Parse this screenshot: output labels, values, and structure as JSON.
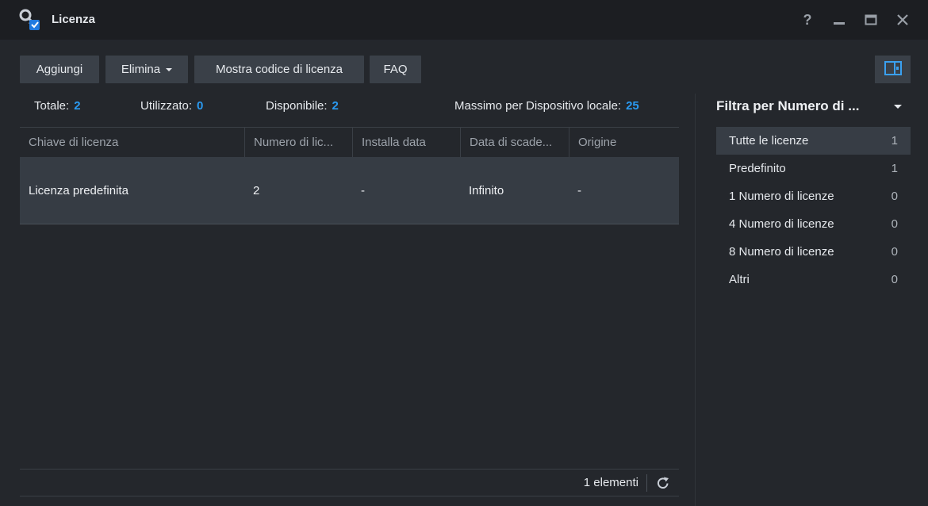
{
  "window": {
    "title": "Licenza"
  },
  "toolbar": {
    "add_label": "Aggiungi",
    "delete_label": "Elimina",
    "show_code_label": "Mostra codice di licenza",
    "faq_label": "FAQ"
  },
  "stats": {
    "total_label": "Totale:",
    "total_value": "2",
    "used_label": "Utilizzato:",
    "used_value": "0",
    "available_label": "Disponibile:",
    "available_value": "2",
    "max_label": "Massimo per Dispositivo locale:",
    "max_value": "25"
  },
  "table": {
    "columns": [
      "Chiave di licenza",
      "Numero di lic...",
      "Installa data",
      "Data di scade...",
      "Origine"
    ],
    "rows": [
      [
        "Licenza predefinita",
        "2",
        "-",
        "Infinito",
        "-"
      ]
    ]
  },
  "footer": {
    "item_count": "1 elementi"
  },
  "sidebar": {
    "title": "Filtra per Numero di ...",
    "items": [
      {
        "label": "Tutte le licenze",
        "count": "1"
      },
      {
        "label": "Predefinito",
        "count": "1"
      },
      {
        "label": "1 Numero di licenze",
        "count": "0"
      },
      {
        "label": "4 Numero di licenze",
        "count": "0"
      },
      {
        "label": "8 Numero di licenze",
        "count": "0"
      },
      {
        "label": "Altri",
        "count": "0"
      }
    ]
  },
  "colors": {
    "accent": "#2a9af1",
    "background": "#24272c",
    "titlebar": "#1c1e22",
    "button": "#3a4048",
    "selected_row": "#363c44"
  },
  "icons": {
    "app": "license-key-icon",
    "help": "help-icon",
    "minimize": "minimize-icon",
    "maximize": "maximize-icon",
    "close": "close-icon",
    "panel": "side-panel-icon",
    "refresh": "refresh-icon"
  }
}
